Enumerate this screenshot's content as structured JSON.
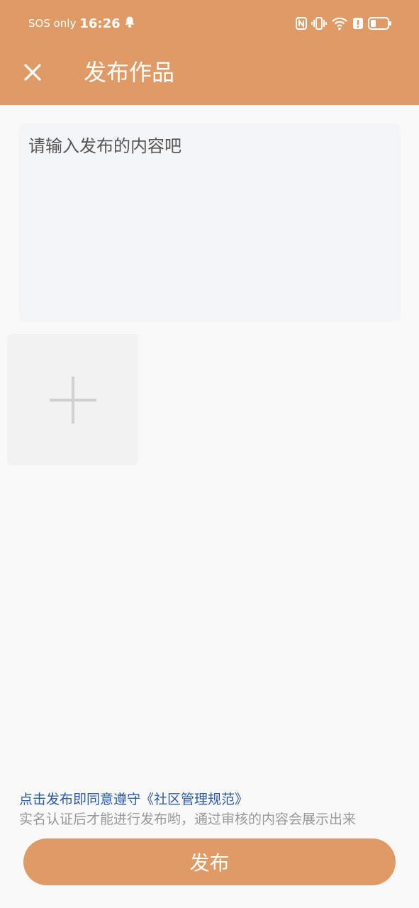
{
  "status_bar": {
    "carrier": "SOS only",
    "time": "16:26"
  },
  "header": {
    "title": "发布作品"
  },
  "editor": {
    "placeholder": "请输入发布的内容吧"
  },
  "footer": {
    "agreement_text": "点击发布即同意遵守《社区管理规范》",
    "notice_text": "实名认证后才能进行发布哟，通过审核的内容会展示出来",
    "publish_label": "发布"
  },
  "colors": {
    "accent": "#e09a66",
    "link": "#2b5aa8",
    "background": "#f9f9f9"
  },
  "icons": {
    "close": "close-icon",
    "add_media": "plus-icon"
  }
}
